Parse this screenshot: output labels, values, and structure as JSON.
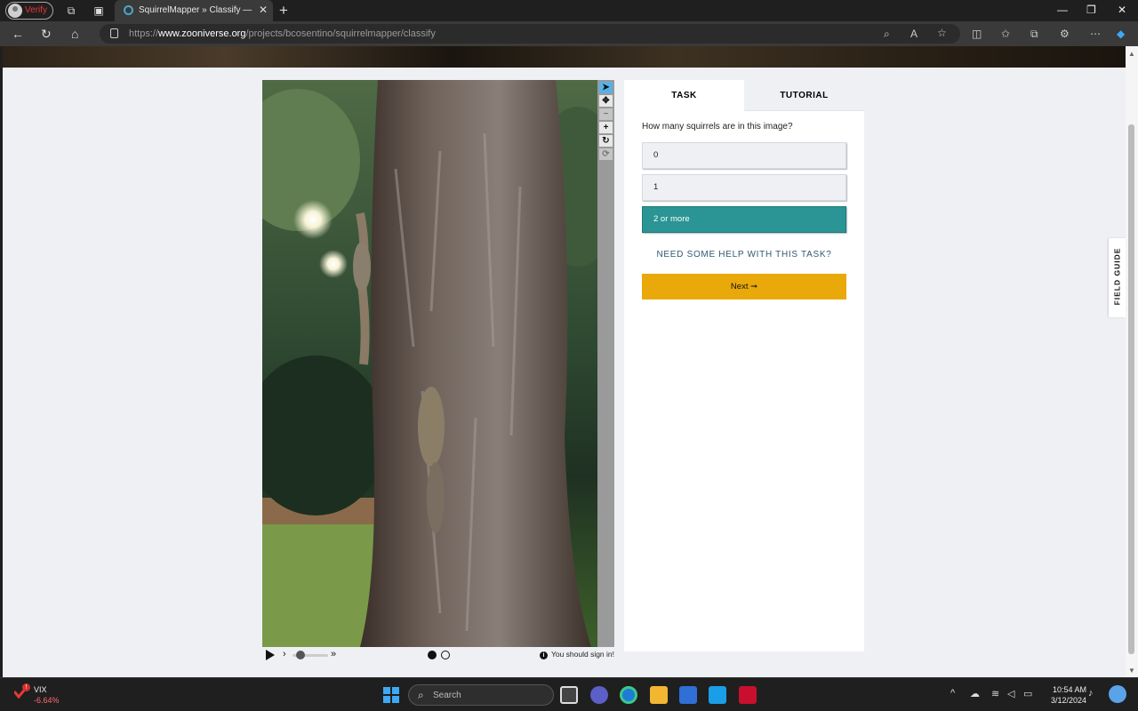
{
  "browser": {
    "profile_name": "Verify",
    "tab_title": "SquirrelMapper » Classify — Zooniverse",
    "url_prefix": "https://",
    "url_domain": "www.zooniverse.org",
    "url_path": "/projects/bcosentino/squirrelmapper/classify"
  },
  "viewer": {
    "signin_notice": "You should sign in!",
    "tools": [
      "pointer-icon",
      "move-icon",
      "zoom-out-icon",
      "zoom-in-icon",
      "rotate-icon",
      "reset-icon"
    ]
  },
  "panel": {
    "tabs": {
      "task": "TASK",
      "tutorial": "TUTORIAL"
    },
    "question": "How many squirrels are in this image?",
    "answers": [
      {
        "label": "0"
      },
      {
        "label": "1"
      },
      {
        "label": "2 or more",
        "selected": true
      }
    ],
    "help_link": "NEED SOME HELP WITH THIS TASK?",
    "next_button": "Next ➞"
  },
  "field_guide": "FIELD GUIDE",
  "taskbar": {
    "ticker_name": "VIX",
    "ticker_change": "-6.64%",
    "search_label": "Search",
    "time": "10:54 AM",
    "date": "3/12/2024"
  },
  "colors": {
    "selected_answer": "#2b9494",
    "next_button": "#e9a90a",
    "help_link": "#2f5a70"
  }
}
